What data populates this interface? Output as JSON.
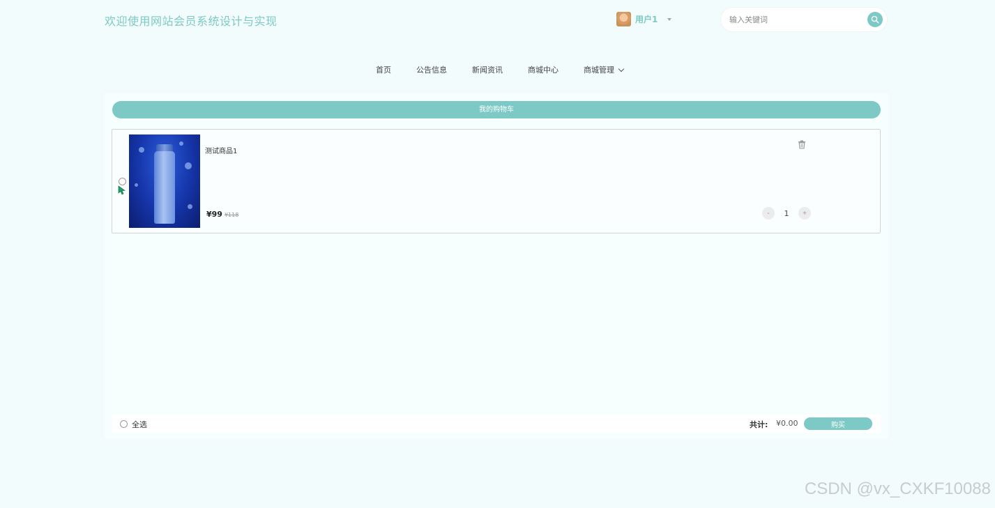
{
  "header": {
    "site_title": "欢迎使用网站会员系统设计与实现",
    "user_name": "用户1",
    "search_placeholder": "输入关键词"
  },
  "nav": {
    "items": [
      "首页",
      "公告信息",
      "新闻资讯",
      "商城中心",
      "商城管理"
    ]
  },
  "cart": {
    "title": "我的购物车",
    "items": [
      {
        "name": "测试商品1",
        "price": "¥99",
        "original_price": "¥118",
        "quantity": "1"
      }
    ],
    "qty_minus": "-",
    "qty_plus": "+"
  },
  "footer": {
    "select_all": "全选",
    "total_label": "共计:",
    "total_value": "¥0.00",
    "buy_label": "购买"
  },
  "watermark": "CSDN @vx_CXKF10088",
  "colors": {
    "accent": "#7cc9c5",
    "background": "#f3fcfc"
  }
}
